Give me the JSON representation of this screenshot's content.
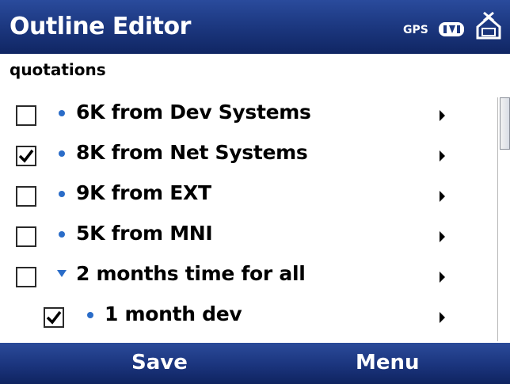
{
  "titlebar": {
    "title": "Outline Editor",
    "gps_label": "GPS",
    "icons": [
      "data-connection-icon",
      "network-status-icon"
    ]
  },
  "document": {
    "title": "quotations"
  },
  "outline": {
    "items": [
      {
        "label": "6K from Dev Systems",
        "checked": false,
        "marker": "bullet",
        "level": 0
      },
      {
        "label": "8K from Net Systems",
        "checked": true,
        "marker": "bullet",
        "level": 0
      },
      {
        "label": "9K from EXT",
        "checked": false,
        "marker": "bullet",
        "level": 0
      },
      {
        "label": "5K from MNI",
        "checked": false,
        "marker": "bullet",
        "level": 0
      },
      {
        "label": "2 months time for all",
        "checked": false,
        "marker": "expanded",
        "level": 0
      },
      {
        "label": "1 month dev",
        "checked": true,
        "marker": "bullet",
        "level": 1
      },
      {
        "label": "",
        "checked": false,
        "marker": "bullet",
        "level": 1
      }
    ]
  },
  "softkeys": {
    "left": "Save",
    "right": "Menu"
  },
  "colors": {
    "bar_dark": "#102663",
    "bar_light": "#2a4b9c",
    "bullet": "#2a6cc8"
  }
}
